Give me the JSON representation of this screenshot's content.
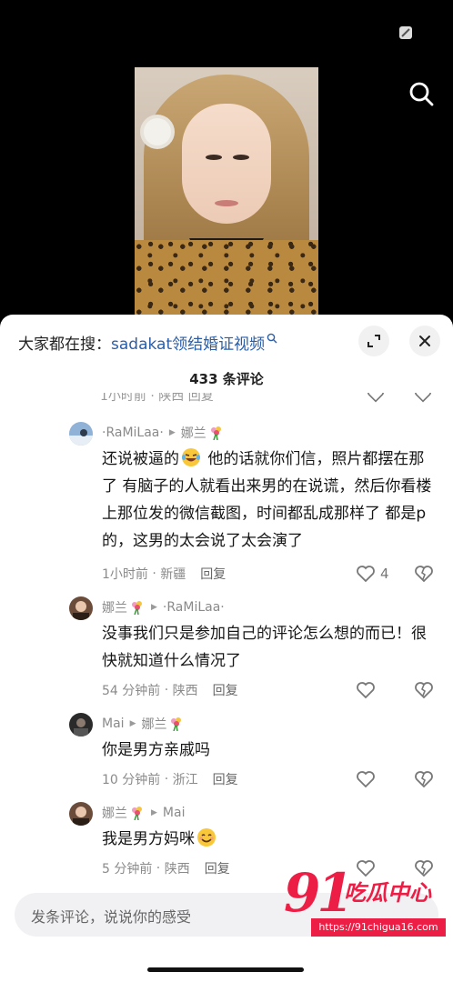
{
  "sheet": {
    "search_prefix": "大家都在搜：",
    "search_term": "sadakat领结婚证视频",
    "comment_count": "433 条评论",
    "ghost_text": "1小时前 · 陕西     回复"
  },
  "comments": [
    {
      "author": "·RaMiLaa·",
      "reply_to": "娜兰",
      "text_before_emoji": "还说被逼的",
      "text_after_emoji": " 他的话就你们信，照片都摆在那了 有脑子的人就看出来男的在说谎，然后你看楼上那位发的微信截图，时间都乱成那样了 都是p的，这男的太会说了太会演了",
      "time": "1小时前",
      "location": "新疆",
      "reply_label": "回复",
      "likes": "4"
    },
    {
      "author": "娜兰",
      "reply_to": "·RaMiLaa·",
      "text": "没事我们只是参加自己的评论怎么想的而已！很快就知道什么情况了",
      "time": "54 分钟前",
      "location": "陕西",
      "reply_label": "回复"
    },
    {
      "author": "Mai",
      "reply_to": "娜兰",
      "text": "你是男方亲戚吗",
      "time": "10 分钟前",
      "location": "浙江",
      "reply_label": "回复"
    },
    {
      "author": "娜兰",
      "reply_to": "Mai",
      "text": "我是男方妈咪",
      "time": "5 分钟前",
      "location": "陕西",
      "reply_label": "回复"
    }
  ],
  "input": {
    "placeholder": "发条评论，说说你的感受"
  },
  "watermark": {
    "number": "91",
    "brand": "吃瓜中心",
    "url": "https://91chigua16.com"
  },
  "colors": {
    "search_term": "#2a5ea9",
    "watermark": "#ed1e45"
  }
}
